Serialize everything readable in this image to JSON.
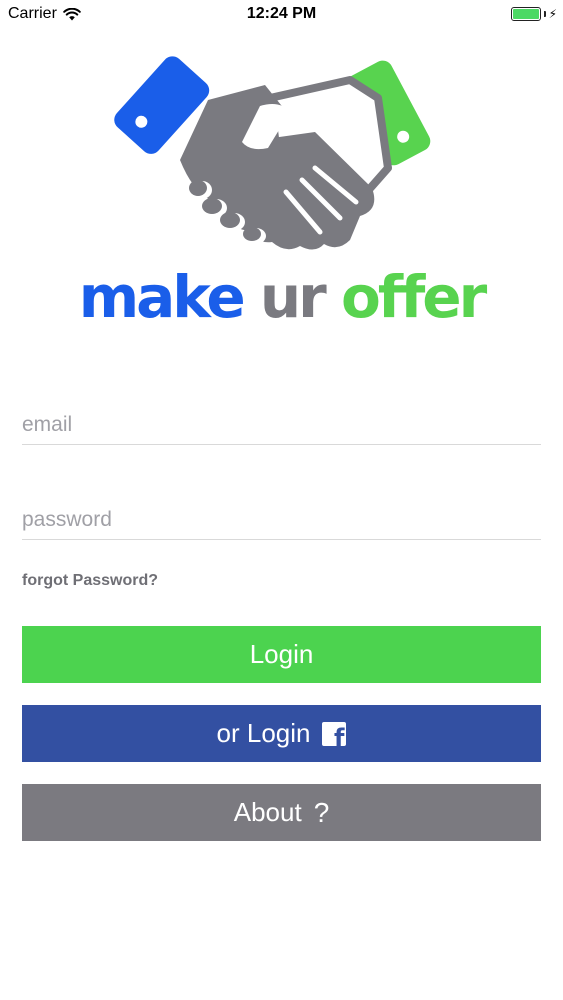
{
  "status_bar": {
    "carrier": "Carrier",
    "time": "12:24 PM",
    "wifi_icon": "wifi-icon",
    "battery_icon": "battery-icon",
    "charging_icon": "bolt-icon",
    "battery_level": 1.0
  },
  "logo": {
    "icon": "handshake-logo",
    "word1": "make",
    "word2": "ur",
    "word3": "offer",
    "colors": {
      "blue": "#1a5ee9",
      "gray": "#7a7a80",
      "green": "#58d34f"
    }
  },
  "form": {
    "email_placeholder": "email",
    "email_value": "",
    "password_placeholder": "password",
    "password_value": "",
    "forgot_label": "forgot Password?"
  },
  "buttons": {
    "login_label": "Login",
    "facebook_label": "or Login",
    "facebook_icon": "facebook-icon",
    "about_label": "About",
    "about_icon": "question-icon",
    "colors": {
      "login": "#4cd34f",
      "facebook": "#3350a2",
      "about": "#7b7a80"
    }
  }
}
